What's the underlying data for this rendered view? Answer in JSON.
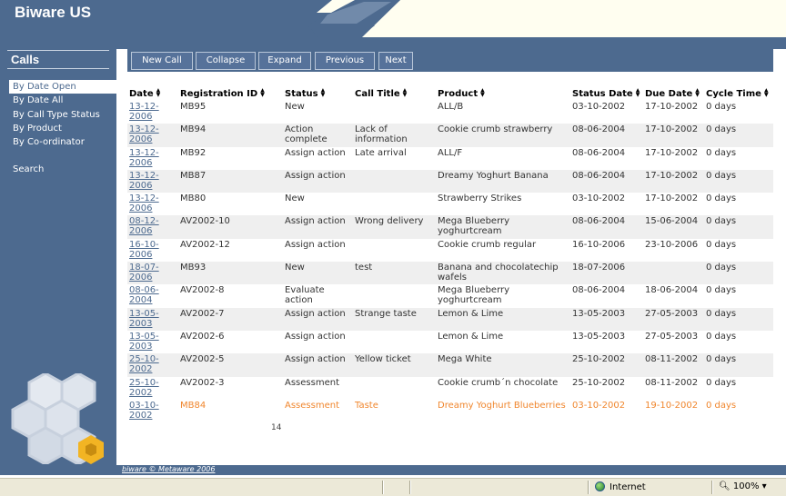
{
  "app": {
    "title": "Biware US"
  },
  "sidebar": {
    "heading": "Calls",
    "items": [
      {
        "label": "By Date Open",
        "active": true
      },
      {
        "label": "By Date All",
        "active": false
      },
      {
        "label": "By Call Type Status",
        "active": false
      },
      {
        "label": "By Product",
        "active": false
      },
      {
        "label": "By Co-ordinator",
        "active": false
      }
    ],
    "search": "Search"
  },
  "toolbar": {
    "new_call": "New Call",
    "collapse": "Collapse",
    "expand": "Expand",
    "previous": "Previous",
    "next": "Next"
  },
  "table": {
    "columns": [
      "Date",
      "Registration ID",
      "Status",
      "Call Title",
      "Product",
      "Status Date",
      "Due Date",
      "Cycle Time"
    ],
    "rows": [
      [
        "13-12-2006",
        "MB95",
        "New",
        "",
        "ALL/B",
        "03-10-2002",
        "17-10-2002",
        "0 days"
      ],
      [
        "13-12-2006",
        "MB94",
        "Action complete",
        "Lack of information",
        "Cookie crumb strawberry",
        "08-06-2004",
        "17-10-2002",
        "0 days"
      ],
      [
        "13-12-2006",
        "MB92",
        "Assign action",
        "Late arrival",
        "ALL/F",
        "08-06-2004",
        "17-10-2002",
        "0 days"
      ],
      [
        "13-12-2006",
        "MB87",
        "Assign action",
        "",
        "Dreamy Yoghurt Banana",
        "08-06-2004",
        "17-10-2002",
        "0 days"
      ],
      [
        "13-12-2006",
        "MB80",
        "New",
        "",
        "Strawberry Strikes",
        "03-10-2002",
        "17-10-2002",
        "0 days"
      ],
      [
        "08-12-2006",
        "AV2002-10",
        "Assign action",
        "Wrong delivery",
        "Mega Blueberry yoghurtcream",
        "08-06-2004",
        "15-06-2004",
        "0 days"
      ],
      [
        "16-10-2006",
        "AV2002-12",
        "Assign action",
        "",
        "Cookie crumb regular",
        "16-10-2006",
        "23-10-2006",
        "0 days"
      ],
      [
        "18-07-2006",
        "MB93",
        "New",
        "test",
        "Banana and chocolatechip wafels",
        "18-07-2006",
        "",
        "0 days"
      ],
      [
        "08-06-2004",
        "AV2002-8",
        "Evaluate action",
        "",
        "Mega Blueberry yoghurtcream",
        "08-06-2004",
        "18-06-2004",
        "0 days"
      ],
      [
        "13-05-2003",
        "AV2002-7",
        "Assign action",
        "Strange taste",
        "Lemon & Lime",
        "13-05-2003",
        "27-05-2003",
        "0 days"
      ],
      [
        "13-05-2003",
        "AV2002-6",
        "Assign action",
        "",
        "Lemon & Lime",
        "13-05-2003",
        "27-05-2003",
        "0 days"
      ],
      [
        "25-10-2002",
        "AV2002-5",
        "Assign action",
        "Yellow ticket",
        "Mega White",
        "25-10-2002",
        "08-11-2002",
        "0 days"
      ],
      [
        "25-10-2002",
        "AV2002-3",
        "Assessment",
        "",
        "Cookie crumb´n chocolate",
        "25-10-2002",
        "08-11-2002",
        "0 days"
      ],
      [
        "03-10-2002",
        "MB84",
        "Assessment",
        "Taste",
        "Dreamy Yoghurt Blueberries",
        "03-10-2002",
        "19-10-2002",
        "0 days"
      ]
    ],
    "highlight_row": 13,
    "page_number": "14"
  },
  "footer": {
    "text": "biware © Metaware 2006"
  },
  "statusbar": {
    "zone": "Internet",
    "zoom": "100%"
  },
  "colors": {
    "brand": "#4d6a8f",
    "highlight": "#f0862d",
    "header_bg": "#fffef0"
  }
}
